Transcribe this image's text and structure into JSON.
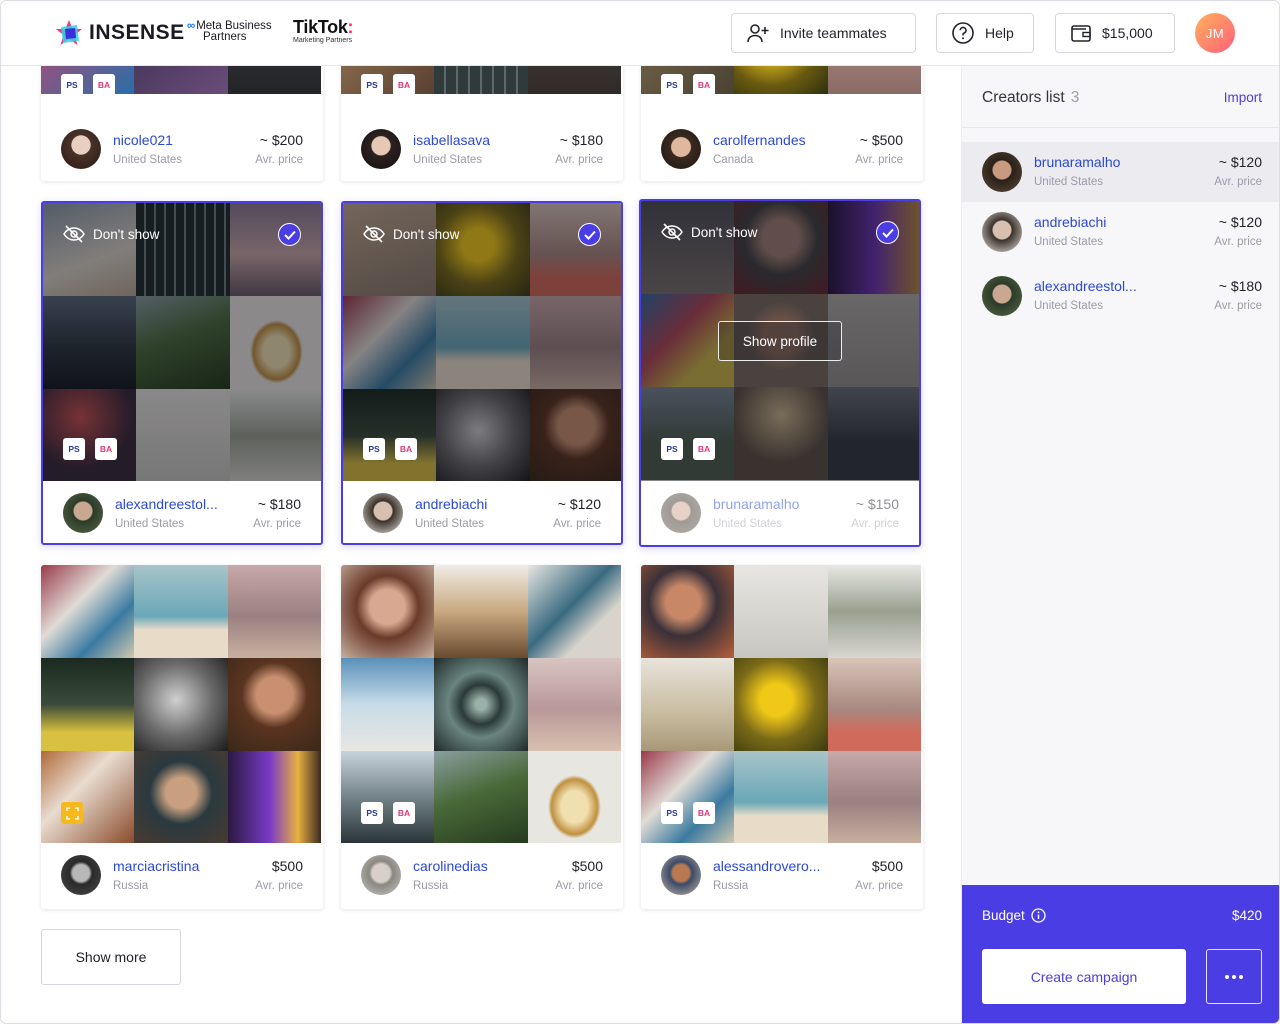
{
  "header": {
    "logo_text": "INSENSE",
    "meta_line1": "Meta Business",
    "meta_line2": "Partners",
    "tiktok_title": "TikTok",
    "tiktok_sub": "Marketing Partners",
    "invite_label": "Invite teammates",
    "help_label": "Help",
    "balance": "$15,000",
    "avatar_initials": "JM"
  },
  "badges": {
    "ps": "PS",
    "ba": "BA"
  },
  "overlay_labels": {
    "dont_show": "Don't show",
    "show_profile": "Show profile"
  },
  "avr_label": "Avr. price",
  "cards": [
    {
      "name": "nicole021",
      "location": "United States",
      "price": "~ $200"
    },
    {
      "name": "isabellasava",
      "location": "United States",
      "price": "~ $180"
    },
    {
      "name": "carolfernandes",
      "location": "Canada",
      "price": "~ $500"
    },
    {
      "name": "alexandreestol...",
      "location": "United States",
      "price": "~ $180",
      "selected": true
    },
    {
      "name": "andrebiachi",
      "location": "United States",
      "price": "~ $120",
      "selected": true
    },
    {
      "name": "brunaramalho",
      "location": "United States",
      "price": "~ $150",
      "selected": true,
      "hovered": true
    },
    {
      "name": "marciacristina",
      "location": "Russia",
      "price": "$500"
    },
    {
      "name": "carolinedias",
      "location": "Russia",
      "price": "$500"
    },
    {
      "name": "alessandrovero...",
      "location": "Russia",
      "price": "$500"
    }
  ],
  "show_more_label": "Show more",
  "sidebar": {
    "title": "Creators list",
    "count": "3",
    "import_label": "Import",
    "creators": [
      {
        "name": "brunaramalho",
        "location": "United States",
        "price": "~ $120",
        "active": true
      },
      {
        "name": "andrebiachi",
        "location": "United States",
        "price": "~ $120"
      },
      {
        "name": "alexandreestol...",
        "location": "United States",
        "price": "~ $180"
      }
    ],
    "budget_label": "Budget",
    "budget_value": "$420",
    "create_label": "Create campaign"
  },
  "colors": {
    "accent": "#4a3de3",
    "link": "#2b48d6",
    "muted": "#9b9ba8"
  }
}
